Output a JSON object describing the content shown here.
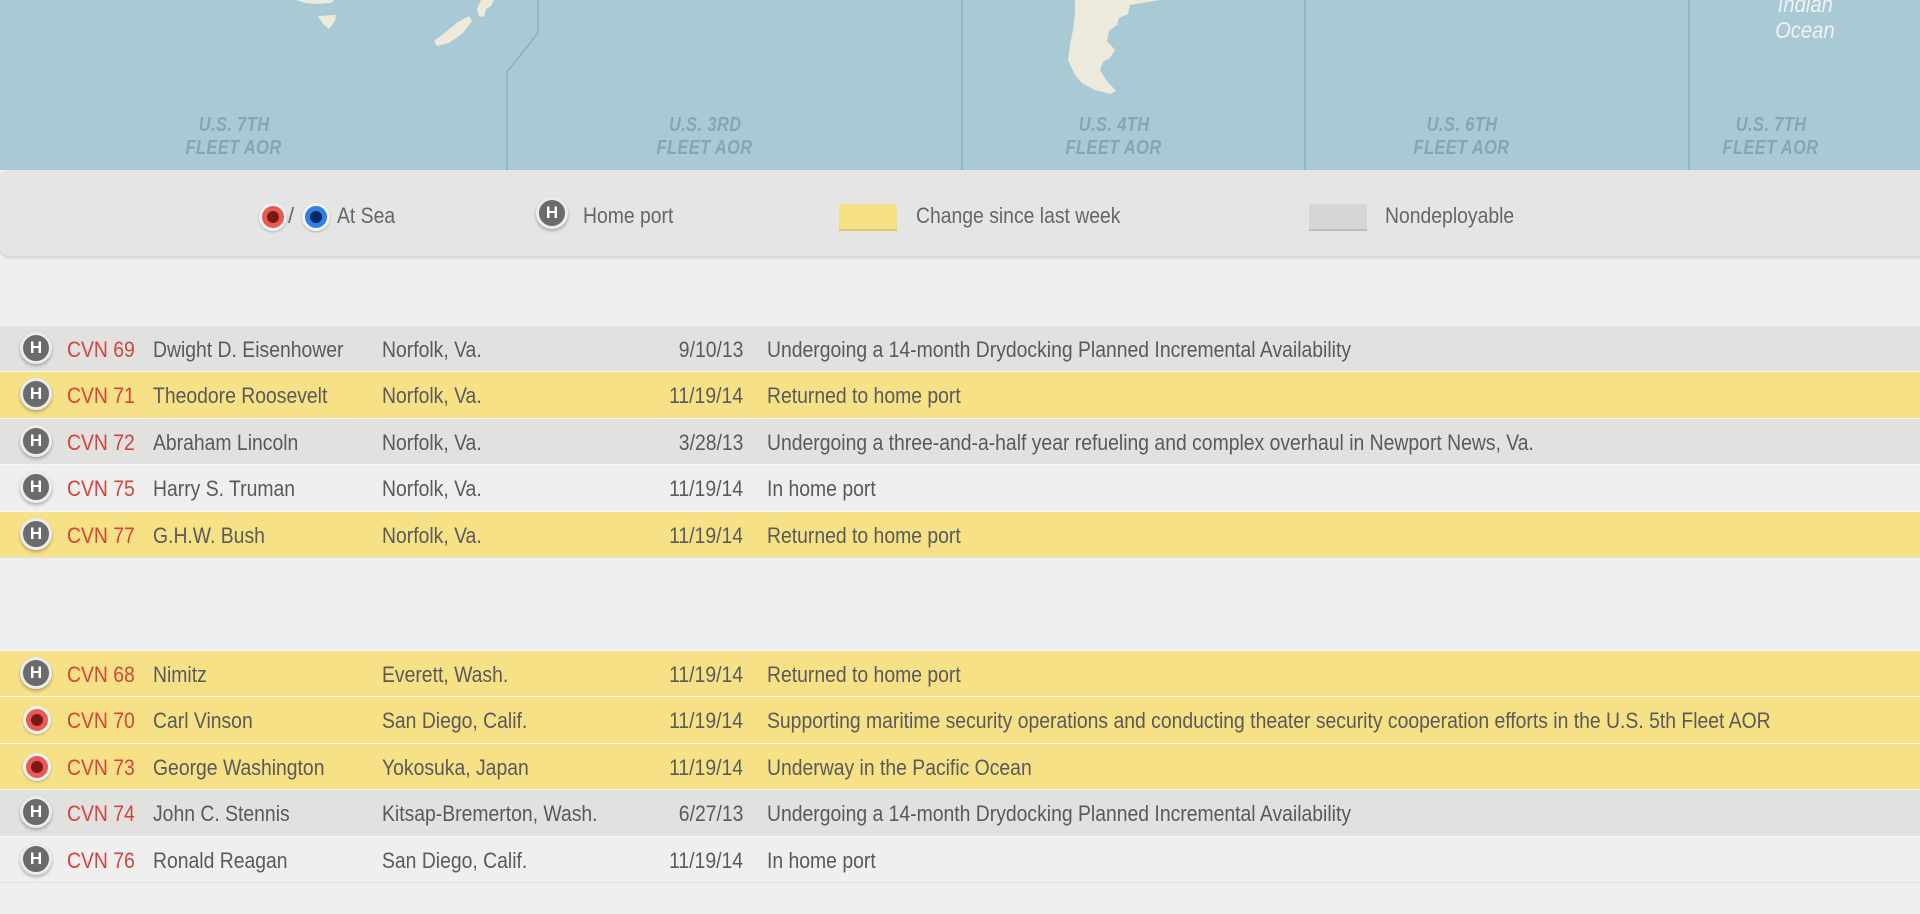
{
  "map": {
    "fleet_labels": [
      {
        "line1": "U.S. 7TH",
        "line2": "FLEET AOR"
      },
      {
        "line1": "U.S. 3RD",
        "line2": "FLEET AOR"
      },
      {
        "line1": "U.S. 4TH",
        "line2": "FLEET AOR"
      },
      {
        "line1": "U.S. 6TH",
        "line2": "FLEET AOR"
      },
      {
        "line1": "U.S. 7TH",
        "line2": "FLEET AOR"
      }
    ],
    "ocean_label": {
      "line1": "Indian",
      "line2": "Ocean"
    }
  },
  "legend": {
    "at_sea_separator": "/",
    "at_sea_label": "At Sea",
    "home_port_label": "Home port",
    "change_label": "Change since last week",
    "nondeployable_label": "Nondeployable"
  },
  "icons": {
    "home_port_letter": "H"
  },
  "colors": {
    "map_water": "#a9c9d4",
    "land": "#eeeadb",
    "changed": "#f7e186",
    "nondeployable": "#e1e1e0",
    "hull_text": "#d5433b",
    "at_sea_red": "#ea5a52",
    "at_sea_blue": "#2f7fe6"
  },
  "groups": [
    {
      "rows": [
        {
          "icon": "home-port",
          "hull": "CVN 69",
          "name": "Dwight D. Eisenhower",
          "home_port": "Norfolk, Va.",
          "date": "9/10/13",
          "status": "Undergoing a 14-month Drydocking Planned Incremental Availability",
          "row_type": "nondeployable"
        },
        {
          "icon": "home-port",
          "hull": "CVN 71",
          "name": "Theodore Roosevelt",
          "home_port": "Norfolk, Va.",
          "date": "11/19/14",
          "status": "Returned to home port",
          "row_type": "changed"
        },
        {
          "icon": "home-port",
          "hull": "CVN 72",
          "name": "Abraham Lincoln",
          "home_port": "Norfolk, Va.",
          "date": "3/28/13",
          "status": "Undergoing a three-and-a-half year refueling and complex overhaul in Newport News, Va.",
          "row_type": "nondeployable"
        },
        {
          "icon": "home-port",
          "hull": "CVN 75",
          "name": "Harry S. Truman",
          "home_port": "Norfolk, Va.",
          "date": "11/19/14",
          "status": "In home port",
          "row_type": "normal"
        },
        {
          "icon": "home-port",
          "hull": "CVN 77",
          "name": "G.H.W. Bush",
          "home_port": "Norfolk, Va.",
          "date": "11/19/14",
          "status": "Returned to home port",
          "row_type": "changed"
        }
      ]
    },
    {
      "rows": [
        {
          "icon": "home-port",
          "hull": "CVN 68",
          "name": "Nimitz",
          "home_port": "Everett, Wash.",
          "date": "11/19/14",
          "status": "Returned to home port",
          "row_type": "changed"
        },
        {
          "icon": "at-sea",
          "hull": "CVN 70",
          "name": "Carl Vinson",
          "home_port": "San Diego, Calif.",
          "date": "11/19/14",
          "status": "Supporting maritime security operations and conducting theater security cooperation efforts in the U.S. 5th Fleet AOR",
          "row_type": "changed"
        },
        {
          "icon": "at-sea",
          "hull": "CVN 73",
          "name": "George Washington",
          "home_port": "Yokosuka, Japan",
          "date": "11/19/14",
          "status": "Underway in the Pacific Ocean",
          "row_type": "changed"
        },
        {
          "icon": "home-port",
          "hull": "CVN 74",
          "name": "John C. Stennis",
          "home_port": "Kitsap-Bremerton, Wash.",
          "date": "6/27/13",
          "status": "Undergoing a 14-month Drydocking Planned Incremental Availability",
          "row_type": "nondeployable"
        },
        {
          "icon": "home-port",
          "hull": "CVN 76",
          "name": "Ronald Reagan",
          "home_port": "San Diego, Calif.",
          "date": "11/19/14",
          "status": "In home port",
          "row_type": "normal"
        }
      ]
    }
  ]
}
